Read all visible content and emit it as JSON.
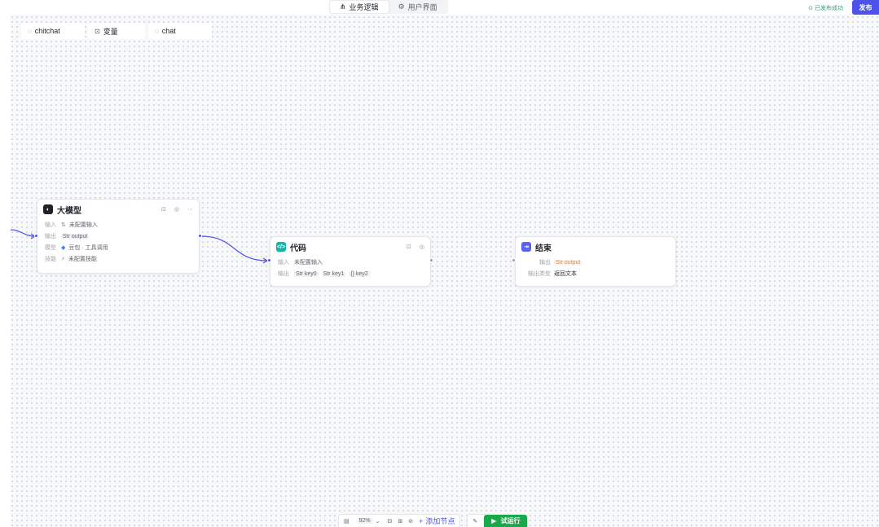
{
  "header": {
    "tabs": [
      {
        "label": "业务逻辑",
        "icon": "flow-icon",
        "active": true
      },
      {
        "label": "用户界面",
        "icon": "ui-icon",
        "active": false
      }
    ],
    "publish_status": "已发布成功",
    "publish_label": "发布"
  },
  "panel_tabs": [
    {
      "label": "chitchat",
      "icon": "chat-bubble-icon"
    },
    {
      "label": "变量",
      "icon": "variable-icon"
    },
    {
      "label": "chat",
      "icon": "chat-bubble-icon"
    }
  ],
  "nodes": {
    "llm": {
      "title": "大模型",
      "icon": "llm-icon",
      "action_icons": [
        "debug-icon",
        "run-icon",
        "more-icon"
      ],
      "rows": [
        {
          "label": "输入",
          "value": "未配置输入",
          "icon": "input-icon"
        },
        {
          "label": "输出",
          "chip": "output",
          "icon": "string-icon"
        },
        {
          "label": "模型",
          "value": "豆包 · 工具调用",
          "icon": "model-icon"
        },
        {
          "label": "技能",
          "value": "未配置技能",
          "icon": "skill-icon"
        }
      ]
    },
    "code": {
      "title": "代码",
      "icon": "code-icon",
      "action_icons": [
        "debug-icon",
        "run-icon"
      ],
      "rows": [
        {
          "label": "输入",
          "value": "未配置输入"
        },
        {
          "label": "输出",
          "chips": [
            "key0",
            "key1",
            "key2"
          ]
        }
      ]
    },
    "end": {
      "title": "结束",
      "icon": "end-icon",
      "rows": [
        {
          "label": "输出",
          "chip": "output"
        },
        {
          "label": "输出类型",
          "value": "返回文本"
        }
      ]
    }
  },
  "toolbar": {
    "zoom": "92%",
    "tool_icons": [
      "minimap-icon",
      "layout-icon",
      "fit-view-icon"
    ],
    "add_node": "添加节点",
    "run_label": "试运行"
  },
  "colors": {
    "accent": "#4d53e8",
    "run_green": "#1ba84a",
    "llm_icon": "#1f2329",
    "code_icon": "#13b5a5",
    "end_icon": "#5c62f0"
  }
}
